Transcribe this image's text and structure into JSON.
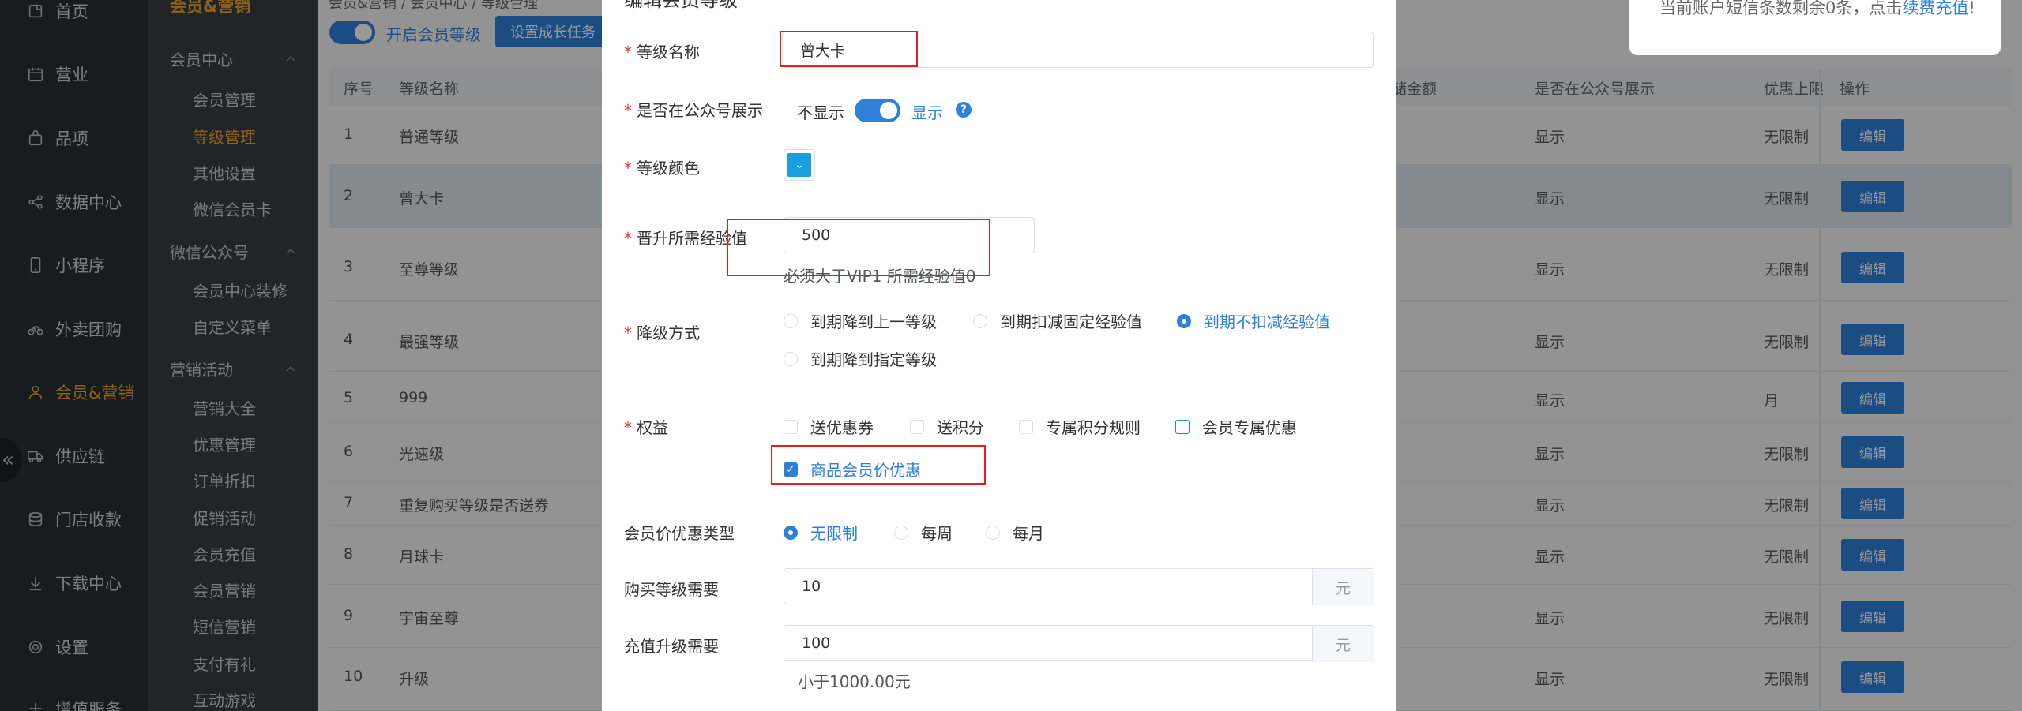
{
  "sidebar_main": {
    "items": [
      {
        "label": "首页",
        "icon": "home-icon"
      },
      {
        "label": "营业",
        "icon": "calendar-icon"
      },
      {
        "label": "品项",
        "icon": "bag-icon"
      },
      {
        "label": "数据中心",
        "icon": "share-icon"
      },
      {
        "label": "小程序",
        "icon": "phone-icon"
      },
      {
        "label": "外卖团购",
        "icon": "bike-icon"
      },
      {
        "label": "会员&营销",
        "icon": "user-icon"
      },
      {
        "label": "供应链",
        "icon": "truck-icon"
      },
      {
        "label": "门店收款",
        "icon": "database-icon"
      },
      {
        "label": "下载中心",
        "icon": "download-icon"
      },
      {
        "label": "设置",
        "icon": "settings-icon"
      },
      {
        "label": "增值服务",
        "icon": "plus-icon"
      }
    ]
  },
  "sidebar_sub": {
    "brand": "会员&营销",
    "groups": [
      {
        "title": "会员中心",
        "items": [
          "会员管理",
          "等级管理",
          "其他设置",
          "微信会员卡"
        ]
      },
      {
        "title": "微信公众号",
        "items": [
          "会员中心装修",
          "自定义菜单"
        ]
      },
      {
        "title": "营销活动",
        "items": [
          "营销大全",
          "优惠管理",
          "订单折扣",
          "促销活动",
          "会员充值",
          "会员营销",
          "短信营销",
          "支付有礼",
          "互动游戏"
        ]
      }
    ]
  },
  "main": {
    "breadcrumb": "会员&营销 / 会员中心 / 等级管理",
    "enable_label": "开启会员等级",
    "growth_button": "设置成长任务",
    "headers": {
      "index": "序号",
      "name": "等级名称",
      "amount": "储金额",
      "show": "是否在公众号展示",
      "limit": "优惠上限",
      "ops": "操作"
    },
    "rows": [
      {
        "index": "1",
        "name": "普通等级",
        "show": "显示",
        "limit": "无限制",
        "edit": "编辑"
      },
      {
        "index": "2",
        "name": "曾大卡",
        "show": "显示",
        "limit": "无限制",
        "edit": "编辑"
      },
      {
        "index": "3",
        "name": "至尊等级",
        "show": "显示",
        "limit": "无限制",
        "edit": "编辑"
      },
      {
        "index": "4",
        "name": "最强等级",
        "show": "显示",
        "limit": "无限制",
        "edit": "编辑"
      },
      {
        "index": "5",
        "name": "999",
        "show": "显示",
        "limit": "月",
        "edit": "编辑"
      },
      {
        "index": "6",
        "name": "光速级",
        "show": "显示",
        "limit": "无限制",
        "edit": "编辑"
      },
      {
        "index": "7",
        "name": "重复购买等级是否送券",
        "show": "显示",
        "limit": "无限制",
        "edit": "编辑"
      },
      {
        "index": "8",
        "name": "月球卡",
        "show": "显示",
        "limit": "无限制",
        "edit": "编辑"
      },
      {
        "index": "9",
        "name": "宇宙至尊",
        "show": "显示",
        "limit": "无限制",
        "edit": "编辑"
      },
      {
        "index": "10",
        "name": "升级",
        "show": "显示",
        "limit": "无限制",
        "edit": "编辑"
      }
    ]
  },
  "toast": {
    "text": "当前账户短信条数剩余0条，点击",
    "link": "续费充值",
    "tail": "!"
  },
  "modal": {
    "title": "编辑会员等级",
    "name_label": "等级名称",
    "name_value": "曾大卡",
    "show_label": "是否在公众号展示",
    "show_off": "不显示",
    "show_on": "显示",
    "color_label": "等级颜色",
    "exp_label": "晋升所需经验值",
    "exp_value": "500",
    "exp_hint": "必须大于VIP1 所需经验值0",
    "downgrade_label": "降级方式",
    "downgrade_options": [
      "到期降到上一等级",
      "到期扣减固定经验值",
      "到期不扣减经验值",
      "到期降到指定等级"
    ],
    "rights_label": "权益",
    "rights_options": [
      "送优惠券",
      "送积分",
      "专属积分规则",
      "会员专属优惠",
      "商品会员价优惠"
    ],
    "price_type_label": "会员价优惠类型",
    "price_type_options": [
      "无限制",
      "每周",
      "每月"
    ],
    "buy_label": "购买等级需要",
    "buy_value": "10",
    "buy_unit": "元",
    "recharge_label": "充值升级需要",
    "recharge_value": "100",
    "recharge_unit": "元",
    "recharge_hint": "小于1000.00元"
  },
  "colors": {
    "accent": "#2f80d9",
    "brand": "#e9a32c",
    "highlight": "#e02020",
    "level_color": "#1a9ee0"
  }
}
